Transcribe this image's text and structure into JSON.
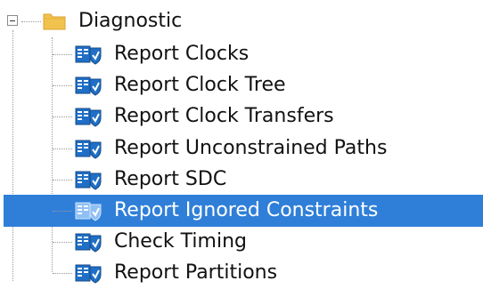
{
  "tree": {
    "root": {
      "label": "Diagnostic",
      "expanded": true,
      "icon": "folder-icon",
      "colors": {
        "folder": "#f2c24f",
        "folder_dark": "#d9a22b"
      }
    },
    "items": [
      {
        "label": "Report Clocks",
        "icon": "report-task-icon",
        "selected": false
      },
      {
        "label": "Report Clock Tree",
        "icon": "report-task-icon",
        "selected": false
      },
      {
        "label": "Report Clock Transfers",
        "icon": "report-task-icon",
        "selected": false
      },
      {
        "label": "Report Unconstrained Paths",
        "icon": "report-task-icon",
        "selected": false
      },
      {
        "label": "Report SDC",
        "icon": "report-task-icon",
        "selected": false
      },
      {
        "label": "Report Ignored Constraints",
        "icon": "report-task-icon",
        "selected": true
      },
      {
        "label": "Check Timing",
        "icon": "report-task-icon",
        "selected": false
      },
      {
        "label": "Report Partitions",
        "icon": "report-task-icon",
        "selected": false
      }
    ],
    "colors": {
      "selection": "#2f7fd8",
      "icon_blue": "#1f6fc6",
      "icon_dark": "#174a86"
    }
  }
}
